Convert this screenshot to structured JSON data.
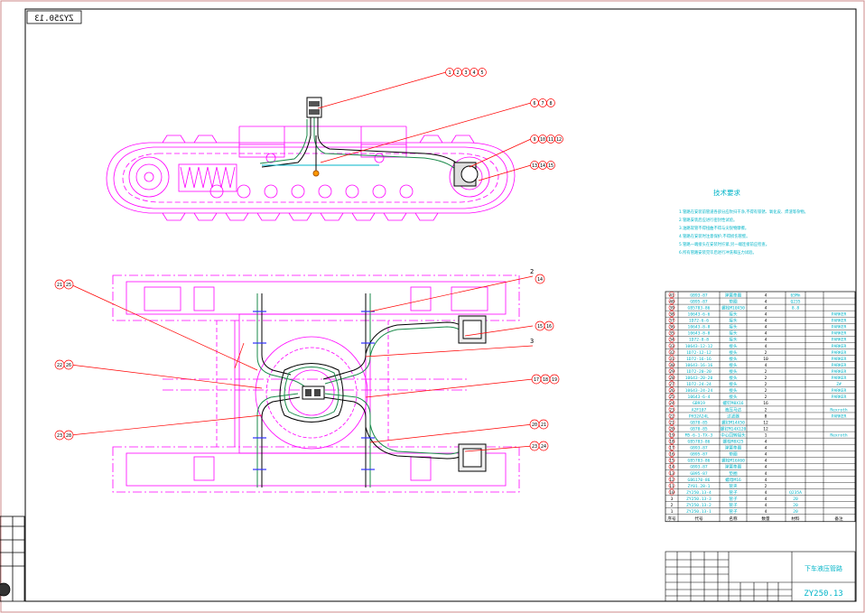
{
  "drawing": {
    "code_mirrored": "ZY250.13",
    "title": "下车液压管路",
    "code": "ZY250.13"
  },
  "balloons_side": [
    "1 2 3 4 5",
    "6 7 8",
    "9 10 11 12",
    "13 14 15"
  ],
  "balloons_plan_left": [
    "21 25",
    "22 26",
    "23 28"
  ],
  "balloons_plan_right": [
    "14",
    "15 16",
    "17 18 19",
    "20 21",
    "23 24"
  ],
  "plan_leader_labels": [
    "2",
    "3"
  ],
  "tech": {
    "heading": "技术要求",
    "lines": [
      "1.管路在安装前管道各部分应吹扫干净,不得有铁锈、氧化皮、焊渣等杂物。",
      "2.管路安装后应进行密封性试验。",
      "3.油路软管不得扭曲不得与尖锐物摩擦。",
      "4.管路在安装时注意保护,不得损伤管壁。",
      "5.管路一端接头在安装时拧紧,另一端连接前应检查。",
      "6.所有管路安装完毕后进行冲洗和压力试验。"
    ]
  },
  "bom": {
    "rows": [
      {
        "no": "41",
        "code": "GB93-87",
        "name": "弹簧垫圈",
        "qty": "4",
        "mat": "65Mn",
        "note": ""
      },
      {
        "no": "40",
        "code": "GB95-87",
        "name": "垫圈",
        "qty": "4",
        "mat": "Q235",
        "note": ""
      },
      {
        "no": "39",
        "code": "GB5783-86",
        "name": "螺栓M10X50",
        "qty": "4",
        "mat": "8.8",
        "note": ""
      },
      {
        "no": "38",
        "code": "10643-6-6",
        "name": "接头",
        "qty": "4",
        "mat": "",
        "note": "PARKER"
      },
      {
        "no": "37",
        "code": "1D72-6-6",
        "name": "接头",
        "qty": "4",
        "mat": "",
        "note": "PARKER"
      },
      {
        "no": "36",
        "code": "10643-8-8",
        "name": "接头",
        "qty": "4",
        "mat": "",
        "note": "PARKER"
      },
      {
        "no": "35",
        "code": "10643-8-8",
        "name": "接头",
        "qty": "4",
        "mat": "",
        "note": "PARKER"
      },
      {
        "no": "34",
        "code": "1D72-8-8",
        "name": "接头",
        "qty": "4",
        "mat": "",
        "note": "PARKER"
      },
      {
        "no": "33",
        "code": "10643-12-12",
        "name": "接头",
        "qty": "4",
        "mat": "",
        "note": "PARKER"
      },
      {
        "no": "32",
        "code": "1D72-12-12",
        "name": "接头",
        "qty": "2",
        "mat": "",
        "note": "PARKER"
      },
      {
        "no": "31",
        "code": "1D72-16-16",
        "name": "接头",
        "qty": "10",
        "mat": "",
        "note": "PARKER"
      },
      {
        "no": "30",
        "code": "10643-16-16",
        "name": "接头",
        "qty": "4",
        "mat": "",
        "note": "PARKER"
      },
      {
        "no": "29",
        "code": "1D72-20-20",
        "name": "接头",
        "qty": "2",
        "mat": "",
        "note": "PARKER"
      },
      {
        "no": "28",
        "code": "10643-20-20",
        "name": "接头",
        "qty": "2",
        "mat": "",
        "note": "PARKER"
      },
      {
        "no": "27",
        "code": "1D72-24-24",
        "name": "接头",
        "qty": "2",
        "mat": "",
        "note": "Ζ#"
      },
      {
        "no": "26",
        "code": "10643-24-24",
        "name": "接头",
        "qty": "2",
        "mat": "",
        "note": "PARKER"
      },
      {
        "no": "25",
        "code": "10643-6-4",
        "name": "接头",
        "qty": "2",
        "mat": "",
        "note": "PARKER"
      },
      {
        "no": "24",
        "code": "GB919",
        "name": "螺钉M8X16",
        "qty": "16",
        "mat": "",
        "note": ""
      },
      {
        "no": "23",
        "code": "A2F107",
        "name": "液压马达",
        "qty": "2",
        "mat": "",
        "note": "Rexroth"
      },
      {
        "no": "22",
        "code": "PH32A24L",
        "name": "过滤器",
        "qty": "8",
        "mat": "",
        "note": "PARKER"
      },
      {
        "no": "21",
        "code": "GB70-85",
        "name": "螺钉M14X50",
        "qty": "12",
        "mat": "",
        "note": ""
      },
      {
        "no": "20",
        "code": "GB70-85",
        "name": "螺钉M14X120",
        "qty": "12",
        "mat": "",
        "note": ""
      },
      {
        "no": "19",
        "code": "M5-6-1-TX-3",
        "name": "中心回转接头",
        "qty": "1",
        "mat": "",
        "note": "Rexroth"
      },
      {
        "no": "18",
        "code": "GB5783-86",
        "name": "螺栓M8X25",
        "qty": "4",
        "mat": "",
        "note": ""
      },
      {
        "no": "17",
        "code": "GB93-87",
        "name": "弹簧垫圈",
        "qty": "4",
        "mat": "",
        "note": ""
      },
      {
        "no": "16",
        "code": "GB95-87",
        "name": "垫圈",
        "qty": "4",
        "mat": "",
        "note": ""
      },
      {
        "no": "15",
        "code": "GB5783-86",
        "name": "螺栓M16X60",
        "qty": "4",
        "mat": "",
        "note": ""
      },
      {
        "no": "14",
        "code": "GB93-87",
        "name": "弹簧垫圈",
        "qty": "4",
        "mat": "",
        "note": ""
      },
      {
        "no": "13",
        "code": "GB95-87",
        "name": "垫圈",
        "qty": "4",
        "mat": "",
        "note": ""
      },
      {
        "no": "12",
        "code": "GB6170-86",
        "name": "螺母M16",
        "qty": "4",
        "mat": "",
        "note": ""
      },
      {
        "no": "11",
        "code": "ZY01.28-1",
        "name": "管夹",
        "qty": "2",
        "mat": "",
        "note": ""
      },
      {
        "no": "10",
        "code": "ZY250.13-4",
        "name": "管子",
        "qty": "4",
        "mat": "Q235A",
        "note": ""
      },
      {
        "no": "3",
        "code": "ZY250.13-3",
        "name": "管子",
        "qty": "4",
        "mat": "20",
        "note": ""
      },
      {
        "no": "2",
        "code": "ZY250.13-2",
        "name": "管子",
        "qty": "4",
        "mat": "20",
        "note": ""
      },
      {
        "no": "1",
        "code": "ZY250.13-1",
        "name": "管子",
        "qty": "4",
        "mat": "20",
        "note": ""
      }
    ],
    "header": {
      "no": "序号",
      "code": "代号",
      "name": "名称",
      "qty": "数量",
      "mat": "材料",
      "note": "备注"
    }
  },
  "colors": {
    "frame": "#000000",
    "magenta": "#ff00ff",
    "green": "#00cc00",
    "red": "#ff0000",
    "cyan": "#00b4c8",
    "blue": "#3030ff",
    "tech_text": "#00b4c8"
  }
}
